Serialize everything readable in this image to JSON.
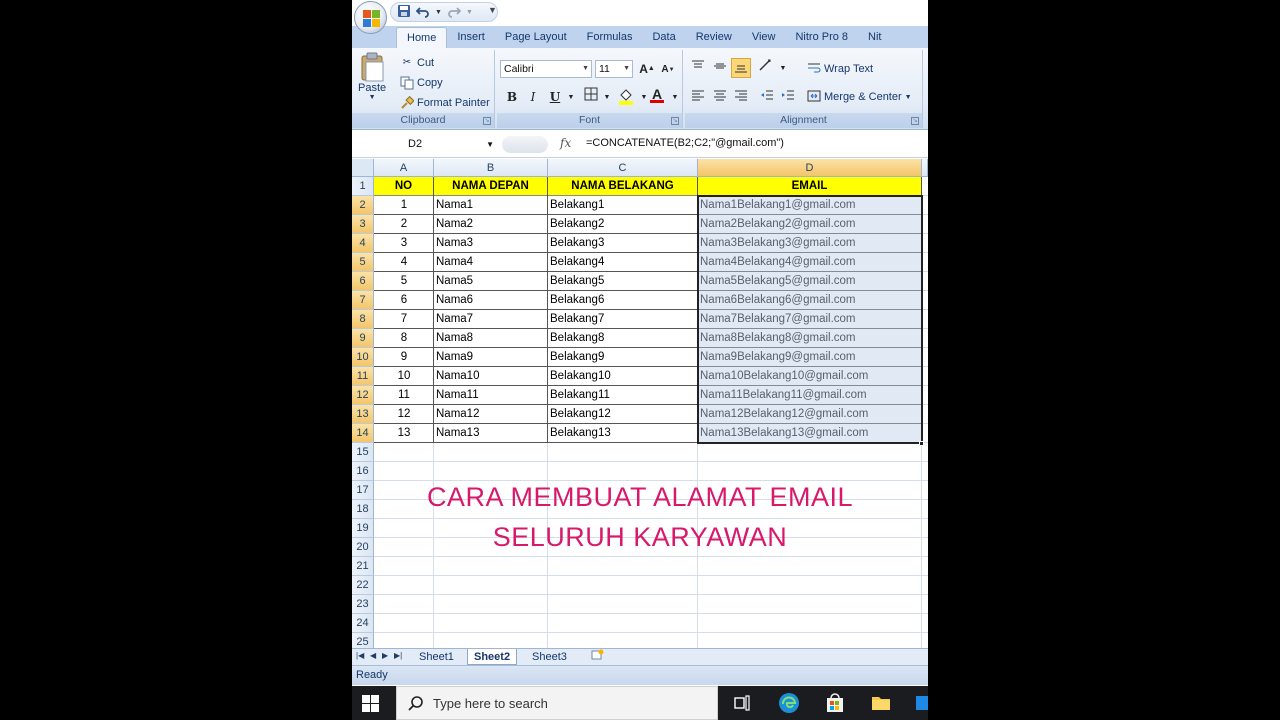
{
  "qat": {
    "save": "save-icon",
    "undo": "undo-icon",
    "redo": "redo-icon"
  },
  "tabs": [
    "Home",
    "Insert",
    "Page Layout",
    "Formulas",
    "Data",
    "Review",
    "View",
    "Nitro Pro 8",
    "Nit"
  ],
  "clipboard": {
    "paste": "Paste",
    "cut": "Cut",
    "copy": "Copy",
    "format_painter": "Format Painter",
    "label": "Clipboard"
  },
  "font": {
    "name": "Calibri",
    "size": "11",
    "bold": "B",
    "italic": "I",
    "underline": "U",
    "grow": "A",
    "shrink": "A",
    "font_color_letter": "A",
    "label": "Font"
  },
  "alignment": {
    "wrap_text": "Wrap Text",
    "merge_center": "Merge & Center",
    "label": "Alignment"
  },
  "formula_bar": {
    "name_box": "D2",
    "fx": "fx",
    "formula": "=CONCATENATE(B2;C2;\"@gmail.com\")"
  },
  "columns": [
    "A",
    "B",
    "C",
    "D"
  ],
  "header_row": [
    "NO",
    "NAMA DEPAN",
    "NAMA BELAKANG",
    "EMAIL"
  ],
  "rows": [
    [
      "1",
      "Nama1",
      "Belakang1",
      "Nama1Belakang1@gmail.com"
    ],
    [
      "2",
      "Nama2",
      "Belakang2",
      "Nama2Belakang2@gmail.com"
    ],
    [
      "3",
      "Nama3",
      "Belakang3",
      "Nama3Belakang3@gmail.com"
    ],
    [
      "4",
      "Nama4",
      "Belakang4",
      "Nama4Belakang4@gmail.com"
    ],
    [
      "5",
      "Nama5",
      "Belakang5",
      "Nama5Belakang5@gmail.com"
    ],
    [
      "6",
      "Nama6",
      "Belakang6",
      "Nama6Belakang6@gmail.com"
    ],
    [
      "7",
      "Nama7",
      "Belakang7",
      "Nama7Belakang7@gmail.com"
    ],
    [
      "8",
      "Nama8",
      "Belakang8",
      "Nama8Belakang8@gmail.com"
    ],
    [
      "9",
      "Nama9",
      "Belakang9",
      "Nama9Belakang9@gmail.com"
    ],
    [
      "10",
      "Nama10",
      "Belakang10",
      "Nama10Belakang10@gmail.com"
    ],
    [
      "11",
      "Nama11",
      "Belakang11",
      "Nama11Belakang11@gmail.com"
    ],
    [
      "12",
      "Nama12",
      "Belakang12",
      "Nama12Belakang12@gmail.com"
    ],
    [
      "13",
      "Nama13",
      "Belakang13",
      "Nama13Belakang13@gmail.com"
    ]
  ],
  "row_numbers": [
    "1",
    "2",
    "3",
    "4",
    "5",
    "6",
    "7",
    "8",
    "9",
    "10",
    "11",
    "12",
    "13",
    "14",
    "15",
    "16",
    "17",
    "18",
    "19",
    "20",
    "21",
    "22",
    "23",
    "24",
    "25"
  ],
  "overlay": {
    "line1": "CARA MEMBUAT ALAMAT EMAIL",
    "line2": "SELURUH KARYAWAN",
    "color": "#d8196b"
  },
  "sheets": [
    "Sheet1",
    "Sheet2",
    "Sheet3"
  ],
  "active_sheet": "Sheet2",
  "status": "Ready",
  "taskbar": {
    "search_placeholder": "Type here to search",
    "icons": [
      "windows-start-icon",
      "search-icon",
      "task-view-icon",
      "edge-icon",
      "store-icon",
      "file-explorer-icon",
      "office-icon"
    ]
  },
  "colors": {
    "header_fill": "#ffff00",
    "selection_fill": "#bccee8",
    "ribbon_tab_bar": "#bfd3ee"
  }
}
